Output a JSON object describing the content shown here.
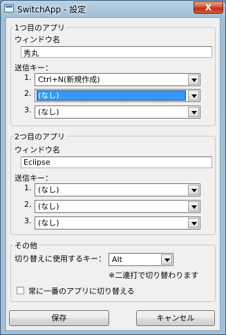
{
  "window": {
    "title": "SwitchApp - 設定",
    "close_glyph": "X"
  },
  "app1": {
    "legend": "1つ目のアプリ",
    "window_name_label": "ウィンドウ名",
    "window_name_value": "秀丸",
    "send_keys_label": "送信キー：",
    "keys": [
      {
        "index": "1.",
        "value": "Ctrl+N(新規作成)"
      },
      {
        "index": "2.",
        "value": "(なし)"
      },
      {
        "index": "3.",
        "value": "(なし)"
      }
    ]
  },
  "app2": {
    "legend": "2つ目のアプリ",
    "window_name_label": "ウィンドウ名",
    "window_name_value": "Eclipse",
    "send_keys_label": "送信キー：",
    "keys": [
      {
        "index": "1.",
        "value": "(なし)"
      },
      {
        "index": "2.",
        "value": "(なし)"
      },
      {
        "index": "3.",
        "value": "(なし)"
      }
    ]
  },
  "other": {
    "legend": "その他",
    "switch_key_label": "切り替えに使用するキー：",
    "switch_key_value": "Alt",
    "note": "※二連打で切り替わります",
    "checkbox_label": "常に一番のアプリに切り替える",
    "checkbox_checked": false
  },
  "buttons": {
    "save": "保存",
    "cancel": "キャンセル"
  },
  "colors": {
    "selection": "#3399ff",
    "close_button": "#c8452a"
  }
}
